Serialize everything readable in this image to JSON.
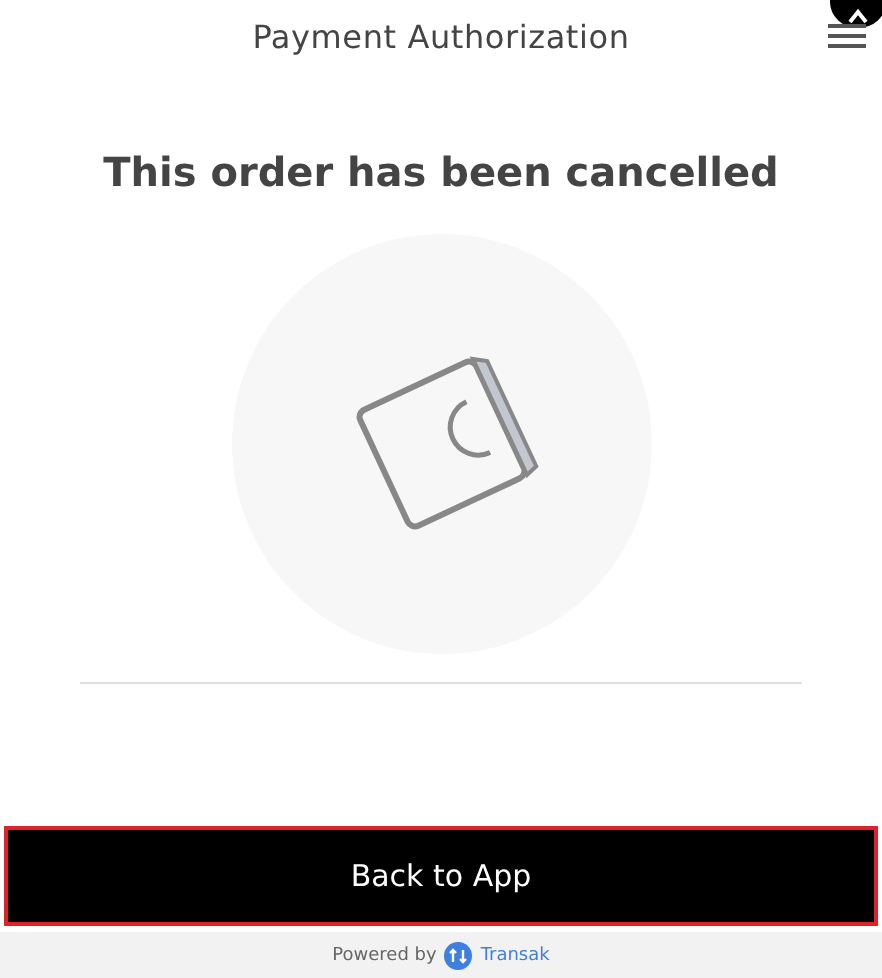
{
  "header": {
    "title": "Payment Authorization"
  },
  "status": {
    "message": "This order has been cancelled"
  },
  "action": {
    "label": "Back to App"
  },
  "footer": {
    "prefix": "Powered by",
    "brand": "Transak"
  }
}
